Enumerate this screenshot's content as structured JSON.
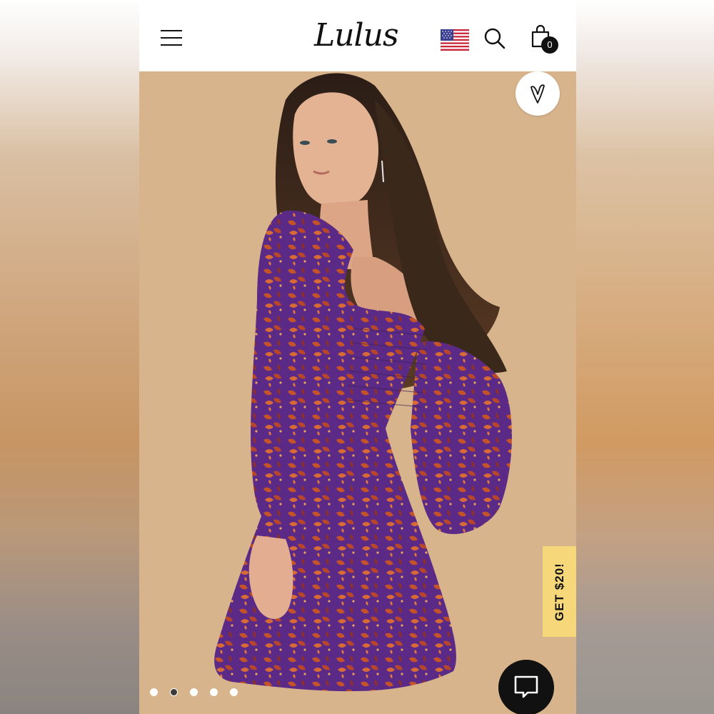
{
  "header": {
    "logo_text": "Lulus",
    "cart_count": "0",
    "country_flag": "us-flag-icon"
  },
  "product_image": {
    "subject": "floral print long-sleeve mini dress",
    "background_color": "#d8b48c"
  },
  "promo": {
    "label": "GET $20!",
    "color": "#f6d77a"
  },
  "carousel": {
    "total": 5,
    "active_index": 1
  },
  "colors": {
    "header_bg": "#ffffff",
    "icon": "#111111",
    "dress_base": "#5b2a86",
    "dress_print": "#c4532a"
  }
}
